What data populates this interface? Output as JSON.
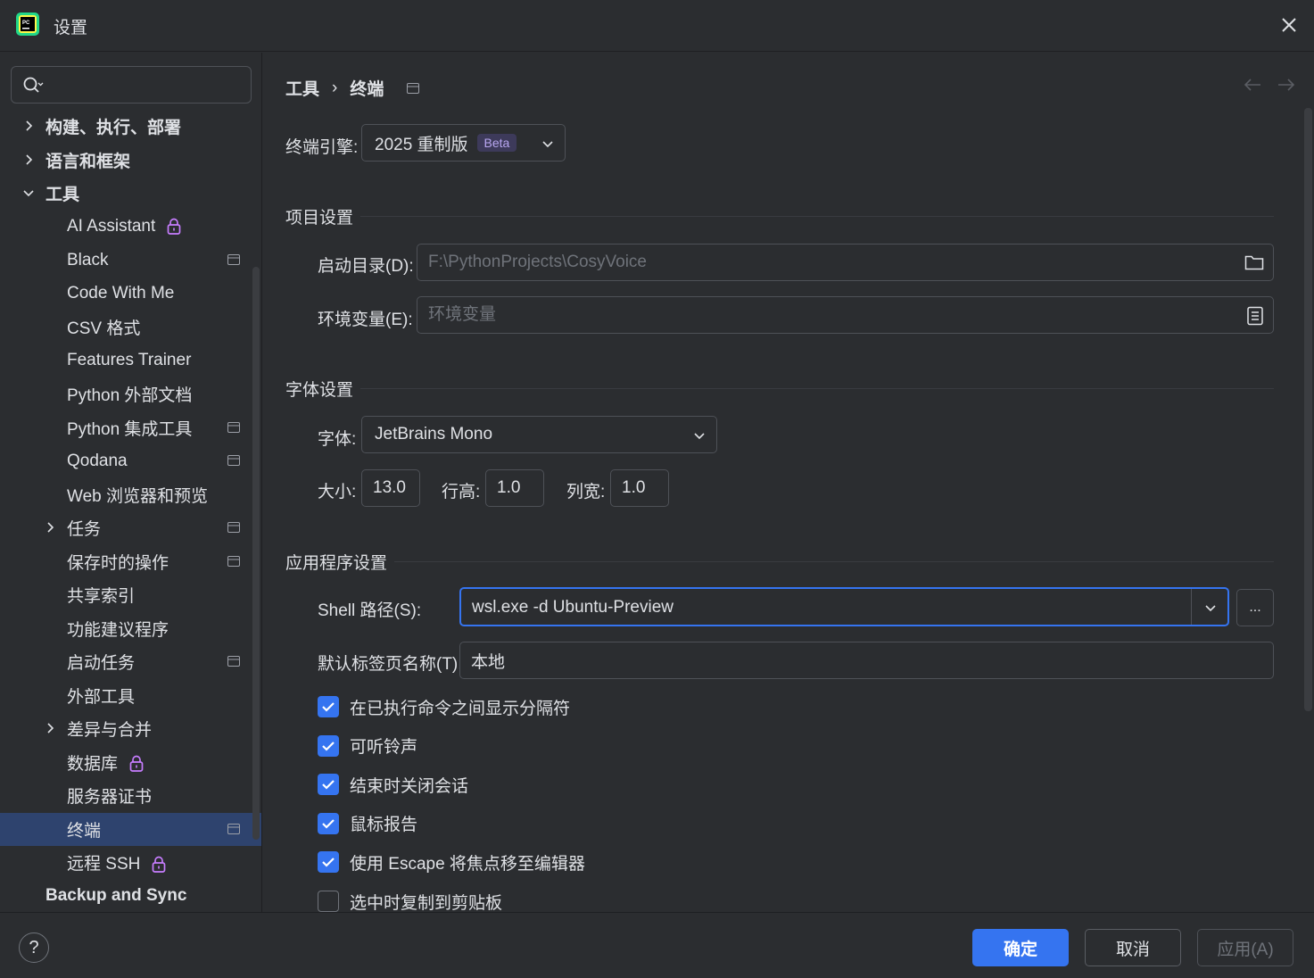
{
  "window": {
    "title": "设置",
    "app_icon": "pycharm-logo",
    "close_icon": "close-icon"
  },
  "search": {
    "value": "",
    "placeholder": ""
  },
  "sidebar": {
    "items": [
      {
        "label": "构建、执行、部署",
        "level": 0,
        "expandable": true,
        "expanded": false,
        "bold": true
      },
      {
        "label": "语言和框架",
        "level": 0,
        "expandable": true,
        "expanded": false,
        "bold": true
      },
      {
        "label": "工具",
        "level": 0,
        "expandable": true,
        "expanded": true,
        "bold": true
      },
      {
        "label": "AI Assistant",
        "level": 1,
        "lock": true
      },
      {
        "label": "Black",
        "level": 1,
        "project": true
      },
      {
        "label": "Code With Me",
        "level": 1
      },
      {
        "label": "CSV 格式",
        "level": 1
      },
      {
        "label": "Features Trainer",
        "level": 1
      },
      {
        "label": "Python 外部文档",
        "level": 1
      },
      {
        "label": "Python 集成工具",
        "level": 1,
        "project": true
      },
      {
        "label": "Qodana",
        "level": 1,
        "project": true
      },
      {
        "label": "Web 浏览器和预览",
        "level": 1
      },
      {
        "label": "任务",
        "level": 1,
        "expandable": true,
        "project": true
      },
      {
        "label": "保存时的操作",
        "level": 1,
        "project": true
      },
      {
        "label": "共享索引",
        "level": 1
      },
      {
        "label": "功能建议程序",
        "level": 1
      },
      {
        "label": "启动任务",
        "level": 1,
        "project": true
      },
      {
        "label": "外部工具",
        "level": 1
      },
      {
        "label": "差异与合并",
        "level": 1,
        "expandable": true
      },
      {
        "label": "数据库",
        "level": 1,
        "lock": true
      },
      {
        "label": "服务器证书",
        "level": 1
      },
      {
        "label": "终端",
        "level": 1,
        "project": true,
        "selected": true
      },
      {
        "label": "远程 SSH",
        "level": 1,
        "lock": true
      },
      {
        "label": "Backup and Sync",
        "level": 0,
        "bold": true
      }
    ]
  },
  "breadcrumb": {
    "parent": "工具",
    "separator": "›",
    "current": "终端"
  },
  "engine": {
    "label": "终端引擎:",
    "value": "2025 重制版",
    "badge": "Beta"
  },
  "project_settings": {
    "title": "项目设置",
    "start_dir_label": "启动目录(D):",
    "start_dir_placeholder": "F:\\PythonProjects\\CosyVoice",
    "env_label": "环境变量(E):",
    "env_placeholder": "环境变量"
  },
  "font_settings": {
    "title": "字体设置",
    "font_label": "字体:",
    "font_value": "JetBrains Mono",
    "size_label": "大小:",
    "size_value": "13.0",
    "line_height_label": "行高:",
    "line_height_value": "1.0",
    "col_width_label": "列宽:",
    "col_width_value": "1.0"
  },
  "app_settings": {
    "title": "应用程序设置",
    "shell_label": "Shell 路径(S):",
    "shell_value": "wsl.exe -d Ubuntu-Preview",
    "browse_label": "...",
    "tab_name_label": "默认标签页名称(T):",
    "tab_name_value": "本地",
    "checkboxes": [
      {
        "label": "在已执行命令之间显示分隔符",
        "checked": true
      },
      {
        "label": "可听铃声",
        "checked": true
      },
      {
        "label": "结束时关闭会话",
        "checked": true
      },
      {
        "label": "鼠标报告",
        "checked": true
      },
      {
        "label": "使用 Escape 将焦点移至编辑器",
        "checked": true
      },
      {
        "label": "选中时复制到剪贴板",
        "checked": false
      }
    ]
  },
  "footer": {
    "help": "?",
    "ok": "确定",
    "cancel": "取消",
    "apply": "应用(A)"
  },
  "colors": {
    "accent": "#3574f0",
    "background": "#2b2d30",
    "selected": "#2e436e",
    "lock": "#c77dff",
    "beta_bg": "#3d3a5a"
  }
}
